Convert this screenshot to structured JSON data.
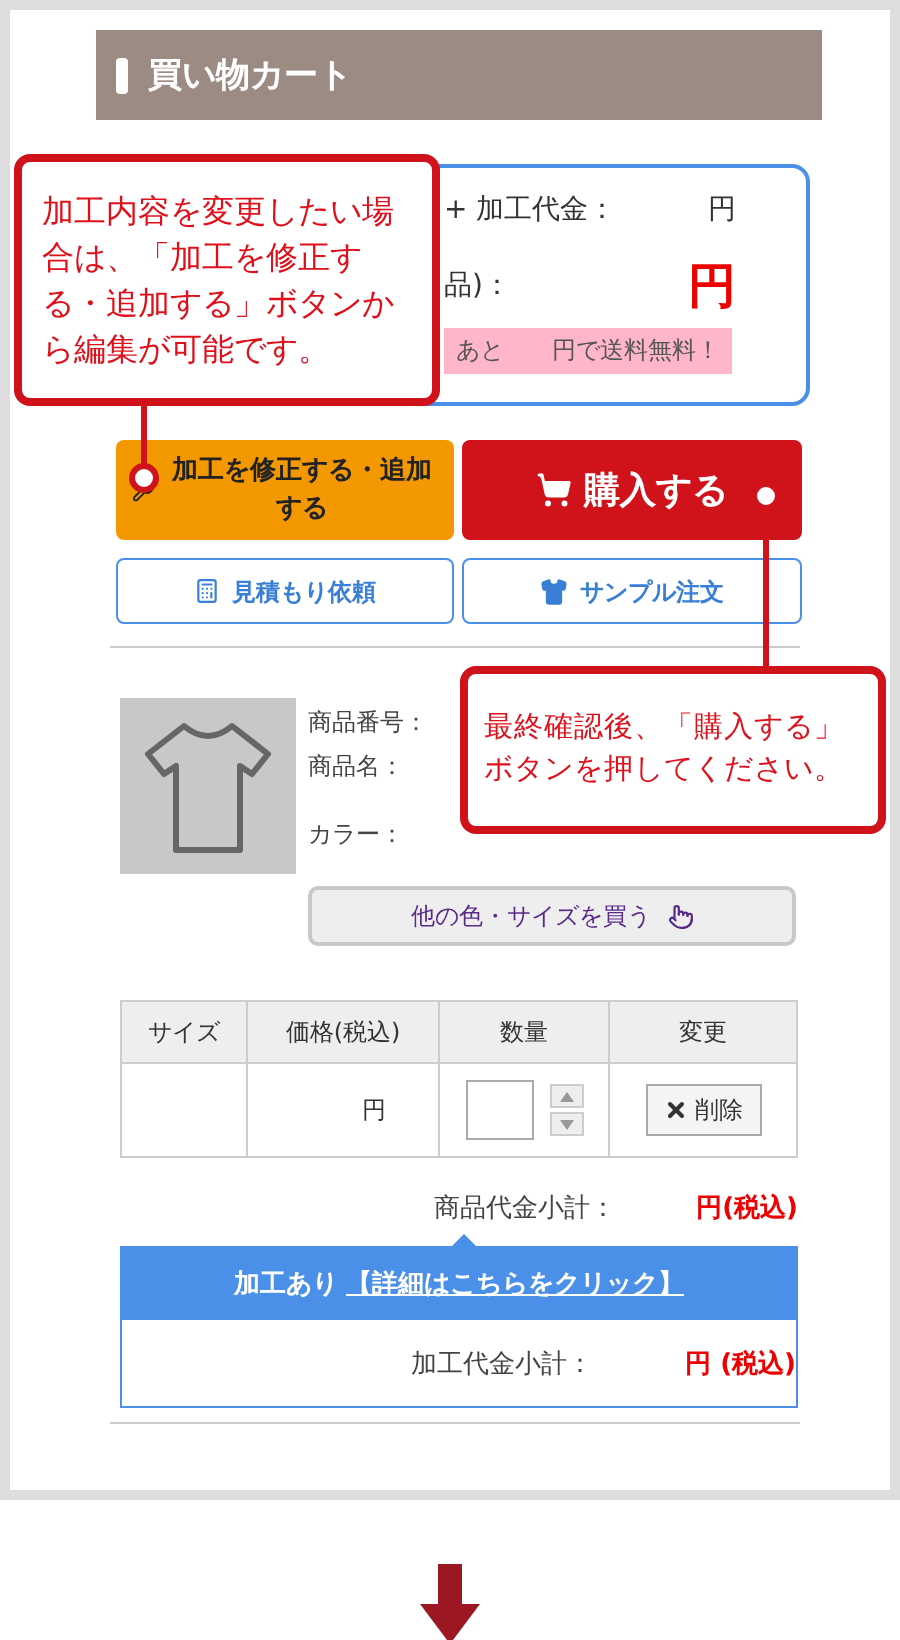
{
  "header": {
    "title": "買い物カート"
  },
  "summary": {
    "processing_label": "+ 加工代金：",
    "processing_value": "円",
    "total_label": "品)：",
    "total_value": "円",
    "shipping_note": "あと　　円で送料無料！"
  },
  "actions": [
    {
      "kind": "edit",
      "label": "加工を修正する・追加する"
    },
    {
      "kind": "buy",
      "label": "購入する"
    },
    {
      "kind": "estimate",
      "label": "見積もり依頼"
    },
    {
      "kind": "sample",
      "label": "サンプル注文"
    }
  ],
  "product": {
    "labels": [
      "商品番号：",
      "商品名：",
      "カラー："
    ],
    "other_button": "他の色・サイズを買う"
  },
  "table": {
    "columns": [
      "サイズ",
      "価格(税込)",
      "数量",
      "変更"
    ],
    "rows": [
      {
        "price": "円",
        "delete": "削除"
      }
    ]
  },
  "subtotal": {
    "label": "商品代金小計：",
    "value": "円(税込)"
  },
  "processing": {
    "title": "加工あり",
    "link": "【詳細はこちらをクリック】",
    "label": "加工代金小計：",
    "value": "円 (税込)"
  },
  "callouts": [
    {
      "text": "加工内容を変更したい場合は、「加工を修正する・追加する」ボタンから編集が可能です。"
    },
    {
      "text": "最終確認後、「購入する」ボタンを押してください。"
    }
  ]
}
